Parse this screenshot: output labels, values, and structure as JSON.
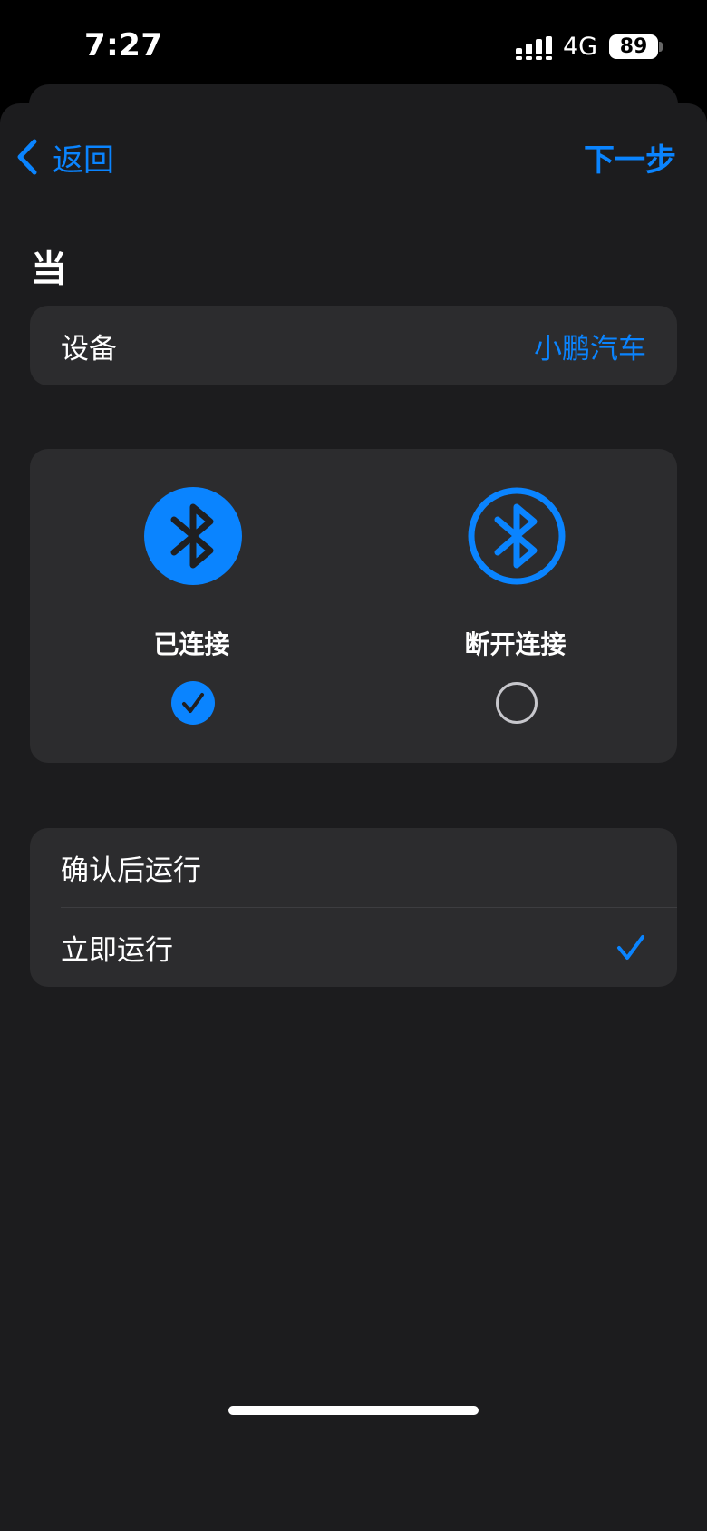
{
  "status_bar": {
    "time": "7:27",
    "network": "4G",
    "battery": "89"
  },
  "nav": {
    "back_label": "返回",
    "next_label": "下一步"
  },
  "section_title": "当",
  "device": {
    "label": "设备",
    "value": "小鹏汽车"
  },
  "bluetooth_options": [
    {
      "label": "已连接",
      "selected": true
    },
    {
      "label": "断开连接",
      "selected": false
    }
  ],
  "run_options": [
    {
      "label": "确认后运行",
      "selected": false
    },
    {
      "label": "立即运行",
      "selected": true
    }
  ],
  "colors": {
    "accent": "#0a84ff",
    "sheet_background": "#1c1c1e",
    "card_background": "#2c2c2e"
  }
}
